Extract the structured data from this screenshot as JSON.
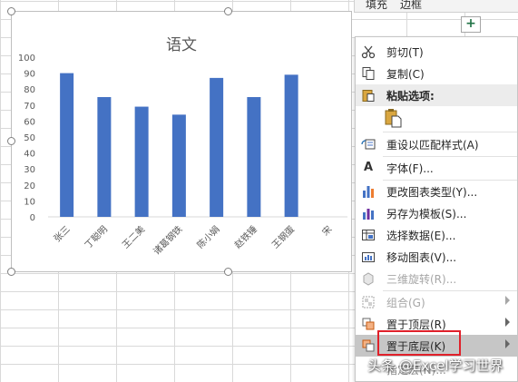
{
  "format_bar": {
    "fill_label": "填充",
    "border_label": "边框"
  },
  "chart_data": {
    "type": "bar",
    "title": "语文",
    "categories": [
      "张三",
      "丁聪明",
      "王二美",
      "诸葛钢铁",
      "陈小娟",
      "赵铁锤",
      "王钢蛋",
      "宋"
    ],
    "values": [
      90,
      75,
      69,
      64,
      87,
      75,
      89
    ],
    "ylim": [
      0,
      100
    ],
    "yticks": [
      0,
      10,
      20,
      30,
      40,
      50,
      60,
      70,
      80,
      90,
      100
    ],
    "bar_color": "#4472c4",
    "grid": false
  },
  "menu": {
    "items": [
      {
        "label": "剪切(T)",
        "icon": "scissors-icon",
        "disabled": false
      },
      {
        "label": "复制(C)",
        "icon": "copy-icon",
        "disabled": false
      },
      {
        "label": "粘贴选项:",
        "icon": "paste-icon",
        "disabled": false
      },
      {
        "label": "重设以匹配样式(A)",
        "icon": "reset-style-icon",
        "disabled": false
      },
      {
        "label": "字体(F)...",
        "icon": "font-icon",
        "disabled": false
      },
      {
        "label": "更改图表类型(Y)...",
        "icon": "chart-type-icon",
        "disabled": false
      },
      {
        "label": "另存为模板(S)...",
        "icon": "save-template-icon",
        "disabled": false
      },
      {
        "label": "选择数据(E)...",
        "icon": "select-data-icon",
        "disabled": false
      },
      {
        "label": "移动图表(V)...",
        "icon": "move-chart-icon",
        "disabled": false
      },
      {
        "label": "三维旋转(R)...",
        "icon": "rotate-3d-icon",
        "disabled": true
      },
      {
        "label": "组合(G)",
        "icon": "group-icon",
        "disabled": true
      },
      {
        "label": "置于顶层(R)",
        "icon": "bring-front-icon",
        "disabled": false
      },
      {
        "label": "置于底层(K)",
        "icon": "send-back-icon",
        "disabled": false
      },
      {
        "label": "指定宏(N)...",
        "icon": "macro-icon",
        "disabled": false
      }
    ]
  },
  "watermark": "头条 @Excel学习世界"
}
